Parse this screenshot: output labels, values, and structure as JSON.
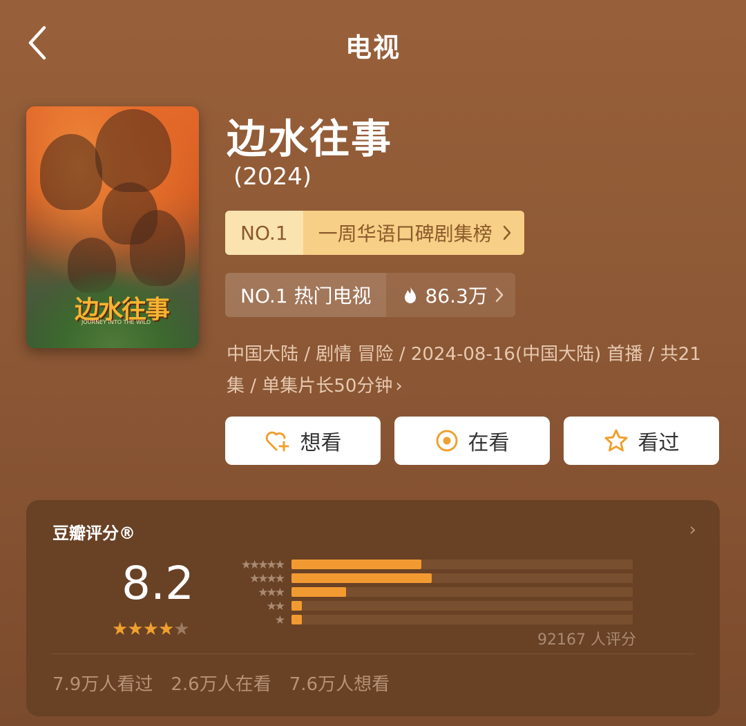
{
  "nav": {
    "title": "电视",
    "back_icon": "chevron-left-icon"
  },
  "poster": {
    "title_text": "边水往事",
    "subtitle_text": "JOURNEY INTO THE WILD"
  },
  "show": {
    "title": "边水往事",
    "year": "(2024)"
  },
  "rankings": [
    {
      "rank": "NO.1",
      "label": "一周华语口碑剧集榜"
    },
    {
      "rank": "NO.1 热门电视",
      "heat": "86.3万"
    }
  ],
  "info_text": "中国大陆 / 剧情 冒险 / 2024-08-16(中国大陆) 首播 / 共21集 / 单集片长50分钟",
  "actions": [
    {
      "label": "想看",
      "icon": "heart-plus-icon"
    },
    {
      "label": "在看",
      "icon": "target-icon"
    },
    {
      "label": "看过",
      "icon": "star-outline-icon"
    }
  ],
  "rating": {
    "title": "豆瓣评分®",
    "score": "8.2",
    "stars_filled": 4,
    "stars_total": 5,
    "distribution": [
      {
        "stars": 5,
        "fraction": 0.38
      },
      {
        "stars": 4,
        "fraction": 0.41
      },
      {
        "stars": 3,
        "fraction": 0.16
      },
      {
        "stars": 2,
        "fraction": 0.03
      },
      {
        "stars": 1,
        "fraction": 0.03
      }
    ],
    "voters": "92167 人评分",
    "stats": [
      "7.9万人看过",
      "2.6万人在看",
      "7.6万人想看"
    ]
  },
  "colors": {
    "accent": "#f29a32",
    "rank_highlight": "#f7cf86"
  }
}
